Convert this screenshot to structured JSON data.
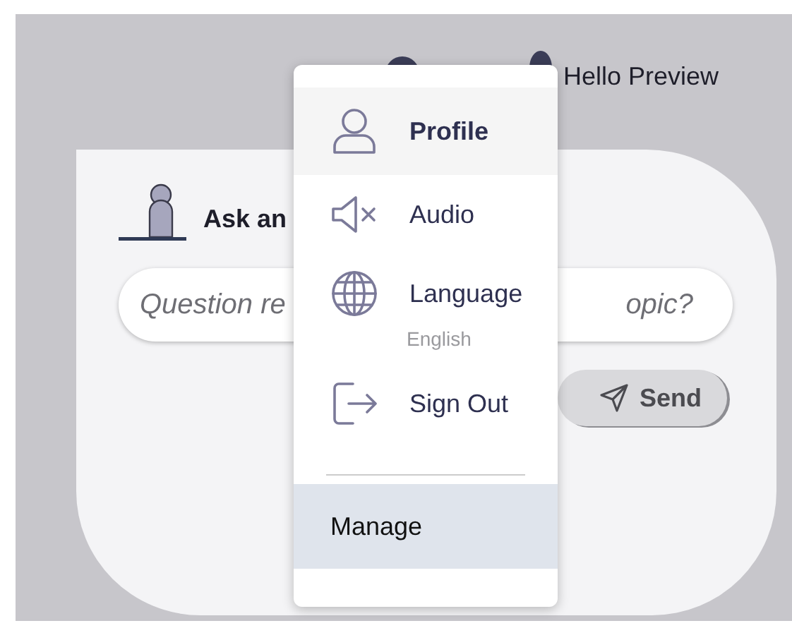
{
  "header": {
    "greeting": "Hello Preview"
  },
  "ask_card": {
    "title": "Ask an",
    "question_field": {
      "placeholder_start": "Question re",
      "placeholder_end": "opic?"
    },
    "send_button": "Send"
  },
  "user_menu": {
    "items": [
      {
        "kind": "person",
        "label": "Profile",
        "selected": true,
        "highlighted": false
      },
      {
        "kind": "mute",
        "label": "Audio",
        "selected": false,
        "highlighted": false
      },
      {
        "kind": "globe",
        "label": "Language",
        "value": "English",
        "selected": false,
        "highlighted": false
      },
      {
        "kind": "exit",
        "label": "Sign Out",
        "selected": false,
        "highlighted": false
      }
    ],
    "footer_items": [
      {
        "kind": "plain",
        "label": "Manage",
        "selected": false,
        "highlighted": true
      }
    ]
  }
}
